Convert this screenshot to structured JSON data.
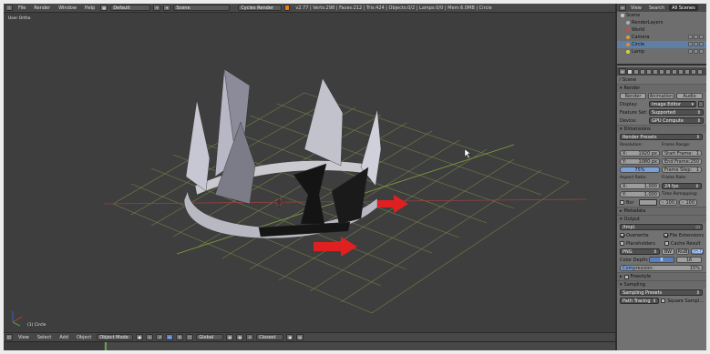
{
  "topbar": {
    "menus": [
      "File",
      "Render",
      "Window",
      "Help"
    ],
    "layout": "Default",
    "scene": "Scene",
    "engine": "Cycles Render",
    "stats": "v2.77 | Verts:298 | Faces:212 | Tris:424 | Objects:0/2 | Lamps:0/0 | Mem:6.0MB | Circle"
  },
  "viewport": {
    "view_label": "User Ortho",
    "object_label": "(1) Circle"
  },
  "bottombar": {
    "menus": [
      "View",
      "Select",
      "Add",
      "Object"
    ],
    "mode": "Object Mode",
    "orientation": "Global",
    "snap": "Closest"
  },
  "outliner": {
    "tabs": [
      "View",
      "Search",
      "All Scenes"
    ],
    "items": [
      {
        "label": "Scene",
        "color": "#c9c9c9"
      },
      {
        "label": "RenderLayers",
        "color": "#b0b0b0"
      },
      {
        "label": "World",
        "color": "#c05050"
      },
      {
        "label": "Camera",
        "color": "#d8a040"
      },
      {
        "label": "Circle",
        "color": "#e09030"
      },
      {
        "label": "Lamp",
        "color": "#d8d040"
      }
    ]
  },
  "properties": {
    "breadcrumb": "Scene",
    "render_section": "Render",
    "render_buttons": [
      "Render",
      "Animation",
      "Audio"
    ],
    "display_label": "Display:",
    "display_value": "Image Editor",
    "feature_label": "Feature Set:",
    "feature_value": "Supported",
    "device_label": "Device:",
    "device_value": "GPU Compute",
    "dimensions_section": "Dimensions",
    "render_presets": "Render Presets",
    "resolution_label": "Resolution:",
    "frame_range_label": "Frame Range:",
    "res_x_label": "X:",
    "res_x": "1920 px",
    "res_y_label": "Y:",
    "res_y": "1080 px",
    "res_pct": "75%",
    "start_frame_label": "Start Frame:",
    "start_frame": "1",
    "end_frame_label": "End Frame:",
    "end_frame": "250",
    "frame_step_label": "Frame Step:",
    "frame_step": "1",
    "aspect_label": "Aspect Ratio:",
    "frame_rate_label": "Frame Rate:",
    "aspect_x_label": "X:",
    "aspect_x": "1.000",
    "aspect_y_label": "Y:",
    "aspect_y": "1.000",
    "frame_rate": "24 fps",
    "time_remap_label": "Time Remapping:",
    "border_label": "Bor",
    "remap_old": "100",
    "remap_new": "100",
    "metadata_section": "Metadata",
    "output_section": "Output",
    "output_path": "/tmp\\",
    "overwrite_label": "Overwrite",
    "file_ext_label": "File Extensions",
    "placeholders_label": "Placeholders",
    "cache_label": "Cache Result",
    "format": "PNG",
    "color_modes": [
      "BW",
      "RGB",
      "RGBA"
    ],
    "color_depth_label": "Color Depth:",
    "depth_8": "8",
    "depth_16": "16",
    "compression_label": "Compression:",
    "compression": "15%",
    "freestyle_section": "Freestyle",
    "sampling_section": "Sampling",
    "sampling_presets": "Sampling Presets",
    "integrator": "Path Tracing",
    "square_samples": "Square Sampl..."
  }
}
